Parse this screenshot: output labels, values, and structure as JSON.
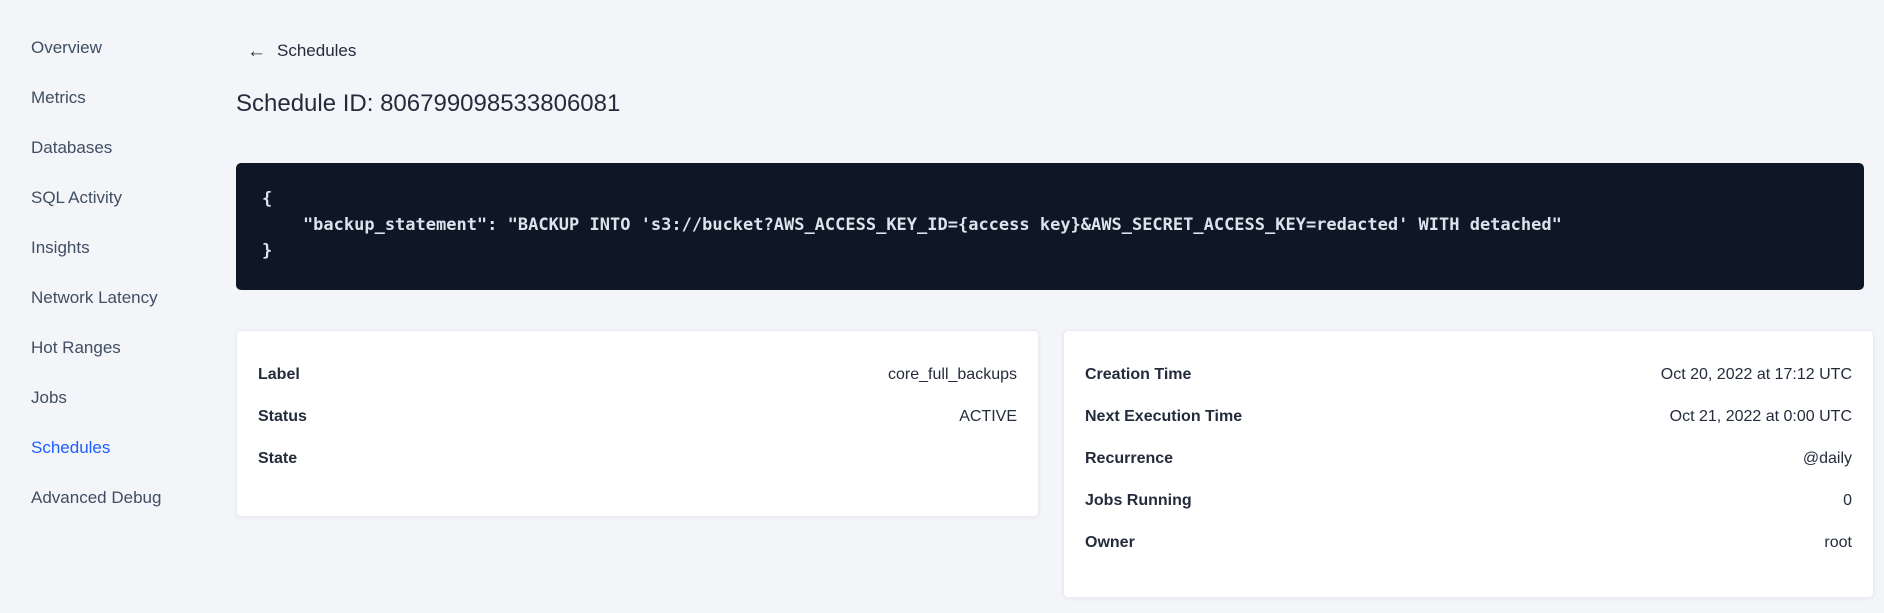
{
  "sidebar": {
    "items": [
      {
        "label": "Overview",
        "active": false
      },
      {
        "label": "Metrics",
        "active": false
      },
      {
        "label": "Databases",
        "active": false
      },
      {
        "label": "SQL Activity",
        "active": false
      },
      {
        "label": "Insights",
        "active": false
      },
      {
        "label": "Network Latency",
        "active": false
      },
      {
        "label": "Hot Ranges",
        "active": false
      },
      {
        "label": "Jobs",
        "active": false
      },
      {
        "label": "Schedules",
        "active": true
      },
      {
        "label": "Advanced Debug",
        "active": false
      }
    ]
  },
  "header": {
    "back_icon": "←",
    "back_label": "Schedules",
    "title": "Schedule ID: 806799098533806081"
  },
  "code_block": {
    "line1": "{",
    "line2": "    \"backup_statement\": \"BACKUP INTO 's3://bucket?AWS_ACCESS_KEY_ID={access key}&AWS_SECRET_ACCESS_KEY=redacted' WITH detached\"",
    "line3": "}"
  },
  "details_left": {
    "rows": [
      {
        "label": "Label",
        "value": "core_full_backups"
      },
      {
        "label": "Status",
        "value": "ACTIVE"
      },
      {
        "label": "State",
        "value": ""
      }
    ]
  },
  "details_right": {
    "rows": [
      {
        "label": "Creation Time",
        "value": "Oct 20, 2022 at 17:12 UTC"
      },
      {
        "label": "Next Execution Time",
        "value": "Oct 21, 2022 at 0:00 UTC"
      },
      {
        "label": "Recurrence",
        "value": "@daily"
      },
      {
        "label": "Jobs Running",
        "value": "0"
      },
      {
        "label": "Owner",
        "value": "root"
      }
    ]
  },
  "colors": {
    "page_background": "#f3f5f9",
    "active_nav_blue": "#1e5eff",
    "code_background": "#0e1726",
    "code_text": "#dce3ec",
    "card_background": "#ffffff",
    "text_primary": "#242c3c"
  }
}
